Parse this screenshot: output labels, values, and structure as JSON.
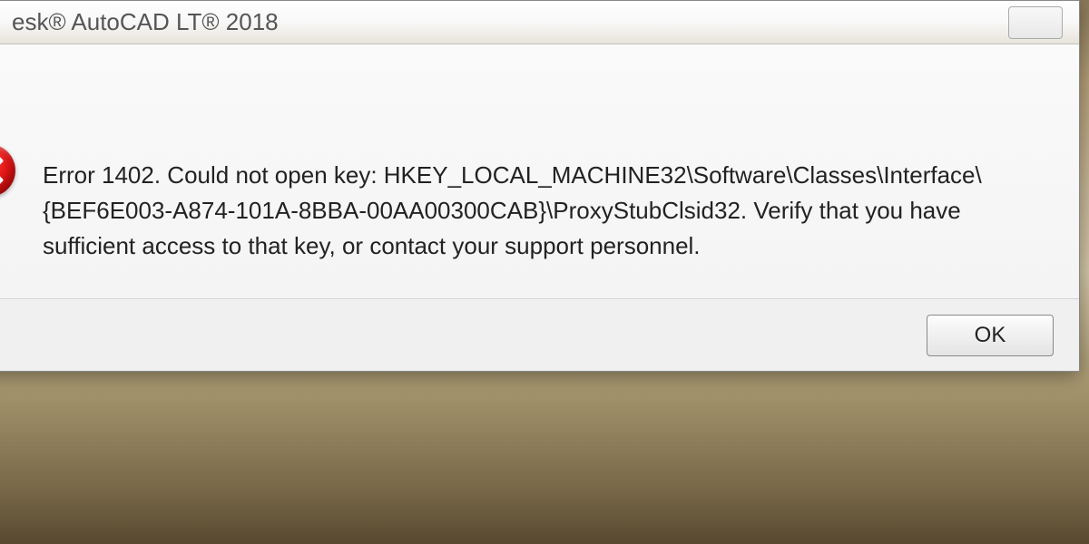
{
  "dialog": {
    "title": "esk® AutoCAD LT® 2018",
    "message": "Error 1402. Could not open key: HKEY_LOCAL_MACHINE32\\Software\\Classes\\Interface\\{BEF6E003-A874-101A-8BBA-00AA00300CAB}\\ProxyStubClsid32.   Verify that you have sufficient access to that key, or contact your support personnel.",
    "ok_label": "OK"
  }
}
